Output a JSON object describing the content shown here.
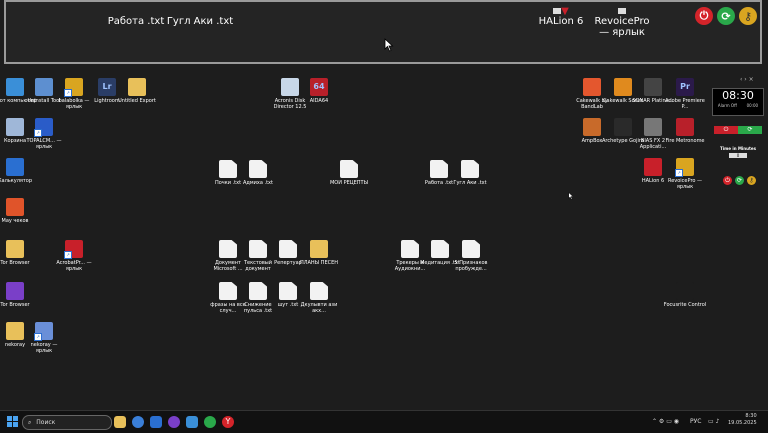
{
  "dock": {
    "items": [
      {
        "label": "Работа .txt"
      },
      {
        "label": "Гугл Аки .txt"
      },
      {
        "label": "HALion 6"
      },
      {
        "label": "RevoicePro",
        "label2": "— ярлык"
      }
    ],
    "controls": [
      {
        "icon": "power-icon",
        "glyph": "⏻",
        "color": "#d4242a"
      },
      {
        "icon": "refresh-icon",
        "glyph": "⟳",
        "color": "#2aa84a"
      },
      {
        "icon": "key-icon",
        "glyph": "⚷",
        "color": "#d9a520"
      }
    ]
  },
  "desktop": {
    "icons": [
      {
        "label": "Этот компьютер",
        "kind": "app",
        "color": "#3a8fd8"
      },
      {
        "label": "Uninstall Tool",
        "kind": "app",
        "color": "#5d8fd0"
      },
      {
        "label": "balabolka — ярлык",
        "kind": "app",
        "color": "#d9a520"
      },
      {
        "label": "Lightroom",
        "kind": "app",
        "color": "#2a3d66",
        "glyph": "Lr"
      },
      {
        "label": "Untitled Export",
        "kind": "folder",
        "color": "#e8c05a"
      },
      {
        "label": "Acronis Disk Director 12.5",
        "kind": "app",
        "color": "#c8d7e8"
      },
      {
        "label": "AIDA64",
        "kind": "app",
        "color": "#b8202a",
        "glyph": "64"
      },
      {
        "label": "Cakewalk by BandLab",
        "kind": "app",
        "color": "#e4572e"
      },
      {
        "label": "Cakewalk Sonar",
        "kind": "app",
        "color": "#e08a1e"
      },
      {
        "label": "SONAR Platinu...",
        "kind": "app",
        "color": "#444"
      },
      {
        "label": "Adobe Premiere P...",
        "kind": "app",
        "color": "#2b1a4a",
        "glyph": "Pr"
      },
      {
        "label": "Корзина",
        "kind": "app",
        "color": "#9fb7d8"
      },
      {
        "label": "TOPALCM... — ярлык",
        "kind": "app",
        "color": "#2a5cc8"
      },
      {
        "label": "AmpBox",
        "kind": "app",
        "color": "#c86a2a"
      },
      {
        "label": "Archetype Gojira",
        "kind": "app",
        "color": "#2a2a2a"
      },
      {
        "label": "BIAS FX 2 Applicati...",
        "kind": "app",
        "color": "#777"
      },
      {
        "label": "Fire Metronome",
        "kind": "app",
        "color": "#b8202a"
      },
      {
        "label": "Калькулятор",
        "kind": "app",
        "color": "#2a6fd1"
      },
      {
        "label": "HALion 6",
        "kind": "app",
        "color": "#c8202a"
      },
      {
        "label": "RevoicePro — ярлык",
        "kind": "app",
        "color": "#d9a520"
      },
      {
        "label": "Почки .txt",
        "kind": "doc"
      },
      {
        "label": "Адмиха .txt",
        "kind": "doc"
      },
      {
        "label": "МОИ РЕЦЕПТЫ",
        "kind": "doc"
      },
      {
        "label": "Работа .txt",
        "kind": "doc"
      },
      {
        "label": "Гугл Аки .txt",
        "kind": "doc"
      },
      {
        "label": "Мay чеков",
        "kind": "app",
        "color": "#e0542a"
      },
      {
        "label": "Tor Browser",
        "kind": "folder",
        "color": "#e8c05a"
      },
      {
        "label": "AcrobatPr... — ярлык",
        "kind": "app",
        "color": "#c8202a"
      },
      {
        "label": "Документ Microsoft ...",
        "kind": "doc"
      },
      {
        "label": "Текстовый документ",
        "kind": "doc"
      },
      {
        "label": "Репертуар",
        "kind": "doc"
      },
      {
        "label": "ПЛАНЫ ПЕСЕН",
        "kind": "folder",
        "color": "#e8c05a"
      },
      {
        "label": "Трекеры и Аудиокни...",
        "kind": "doc"
      },
      {
        "label": "Медитация .txt",
        "kind": "doc"
      },
      {
        "label": "5 Признаков пробужде...",
        "kind": "doc"
      },
      {
        "label": "Tor Browser",
        "kind": "app",
        "color": "#7a3fc8"
      },
      {
        "label": "фразы на все случ...",
        "kind": "doc"
      },
      {
        "label": "Снижение пульса .txt",
        "kind": "doc"
      },
      {
        "label": "шут .txt",
        "kind": "doc"
      },
      {
        "label": "Дкулывти ази акх...",
        "kind": "doc"
      },
      {
        "label": "Focusrite Control",
        "kind": "app",
        "color": "#1d1d1d"
      },
      {
        "label": "nekoray",
        "kind": "folder",
        "color": "#e8c05a"
      },
      {
        "label": "nekoray — ярлык",
        "kind": "app",
        "color": "#6a8fd8"
      }
    ]
  },
  "widget": {
    "clock_time": "08:30",
    "alarm": "Alarm Off",
    "alarm_time": "00:00",
    "timer_label": "Time in Minutes",
    "timer_value": "0",
    "arrows": "‹ ›  ×"
  },
  "taskbar": {
    "search_placeholder": "Поиск",
    "lang": "РУС",
    "time": "8:30",
    "date": "19.05.2025"
  }
}
